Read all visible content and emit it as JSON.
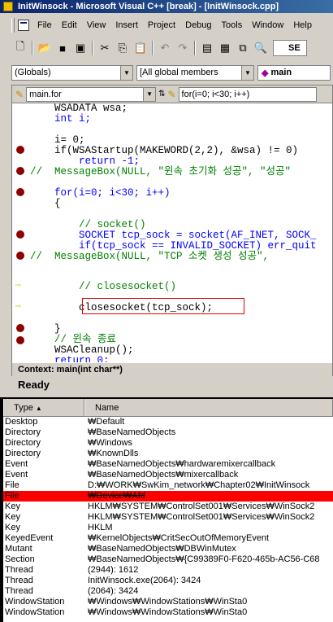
{
  "window": {
    "title": "InitWinsock - Microsoft Visual C++ [break] - [InitWinsock.cpp]"
  },
  "menu": [
    "File",
    "Edit",
    "View",
    "Insert",
    "Project",
    "Debug",
    "Tools",
    "Window",
    "Help"
  ],
  "toolbar": {
    "buttons": [
      "new-icon",
      "open-icon",
      "save-icon",
      "save-all-icon",
      "cut-icon",
      "copy-icon",
      "paste-icon",
      "undo-icon",
      "redo-icon",
      "workspace-icon",
      "output-icon",
      "windows-icon",
      "find-in-files-icon"
    ],
    "search_label": "SE"
  },
  "wizard": {
    "scope": "(Globals)",
    "members": "[All global members",
    "function": "main"
  },
  "editor": {
    "file_combo": "main.for",
    "location_combo": "for(i=0; i<30; i++)",
    "lines": [
      "    WSADATA wsa;",
      "    int i;",
      "",
      "    i= 0;",
      "    if(WSAStartup(MAKEWORD(2,2), &wsa) != 0)",
      "        return -1;",
      "//  MessageBox(NULL, \"윈속 초기화 성공\", \"성공\"",
      "",
      "    for(i=0; i<30; i++)",
      "    {",
      "",
      "        // socket()",
      "        SOCKET tcp_sock = socket(AF_INET, SOCK_",
      "        if(tcp_sock == INVALID_SOCKET) err_quit",
      "//  MessageBox(NULL, \"TCP 소켓 생성 성공\",",
      "",
      "        // closesocket()",
      "        closesocket(tcp_sock);",
      "",
      "    }",
      "    // 윈속 종료",
      "    WSACleanup();",
      "    return 0;"
    ],
    "bottom_tab": "Context: main(int char**)"
  },
  "status": {
    "text": "Ready"
  },
  "handles": {
    "col_type": "Type",
    "col_name": "Name",
    "rows": [
      {
        "type": "Desktop",
        "name": "₩Default"
      },
      {
        "type": "Directory",
        "name": "₩BaseNamedObjects"
      },
      {
        "type": "Directory",
        "name": "₩Windows"
      },
      {
        "type": "Directory",
        "name": "₩KnownDlls"
      },
      {
        "type": "Event",
        "name": "₩BaseNamedObjects₩hardwaremixercallback"
      },
      {
        "type": "Event",
        "name": "₩BaseNamedObjects₩mixercallback"
      },
      {
        "type": "File",
        "name": "D:₩WORK₩SwKim_network₩Chapter02₩InitWinsock"
      },
      {
        "type": "File",
        "name": "₩Device₩Afd"
      },
      {
        "type": "Key",
        "name": "HKLM₩SYSTEM₩ControlSet001₩Services₩WinSock2"
      },
      {
        "type": "Key",
        "name": "HKLM₩SYSTEM₩ControlSet001₩Services₩WinSock2"
      },
      {
        "type": "Key",
        "name": "HKLM"
      },
      {
        "type": "KeyedEvent",
        "name": "₩KernelObjects₩CritSecOutOfMemoryEvent"
      },
      {
        "type": "Mutant",
        "name": "₩BaseNamedObjects₩DBWinMutex"
      },
      {
        "type": "Section",
        "name": "₩BaseNamedObjects₩{C99389F0-F620-465b-AC56-C68"
      },
      {
        "type": "Thread",
        "name": "(2944): 1612"
      },
      {
        "type": "Thread",
        "name": "InitWinsock.exe(2064): 3424"
      },
      {
        "type": "Thread",
        "name": "(2064): 3424"
      },
      {
        "type": "WindowStation",
        "name": "₩Windows₩WindowStations₩WinSta0"
      },
      {
        "type": "WindowStation",
        "name": "₩Windows₩WindowStations₩WinSta0"
      }
    ]
  },
  "colors": {
    "selected_row": "#ff0000",
    "breakpoint": "#8b0000",
    "keyword": "#0000ff",
    "comment": "#008000"
  }
}
